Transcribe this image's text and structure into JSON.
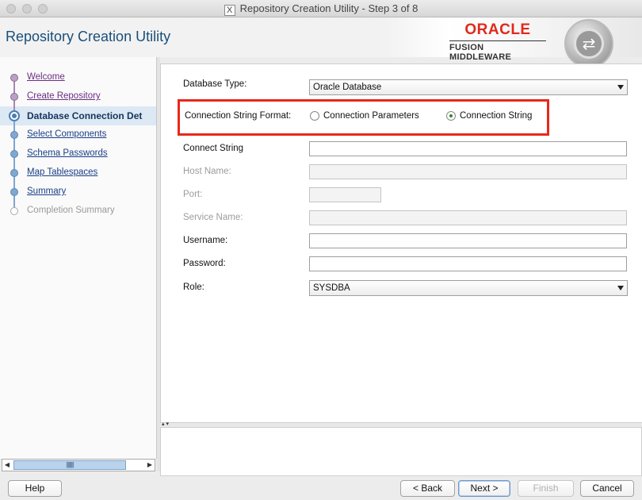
{
  "window": {
    "title": "Repository Creation Utility - Step 3 of 8"
  },
  "header": {
    "app_title": "Repository Creation Utility",
    "brand_name": "ORACLE",
    "brand_product": "FUSION MIDDLEWARE"
  },
  "nav": {
    "items": [
      {
        "label": "Welcome",
        "state": "visited"
      },
      {
        "label": "Create Repository",
        "state": "visited"
      },
      {
        "label": "Database Connection Det",
        "state": "current"
      },
      {
        "label": "Select Components",
        "state": "link"
      },
      {
        "label": "Schema Passwords",
        "state": "link"
      },
      {
        "label": "Map Tablespaces",
        "state": "link"
      },
      {
        "label": "Summary",
        "state": "link"
      },
      {
        "label": "Completion Summary",
        "state": "pending"
      }
    ]
  },
  "form": {
    "database_type_label": "Database Type:",
    "database_type_value": "Oracle Database",
    "connection_format_label": "Connection String Format:",
    "radio_parameters_label": "Connection Parameters",
    "radio_string_label": "Connection String",
    "selected_format": "Connection String",
    "connect_string_label": "Connect String",
    "connect_string_value": "",
    "host_name_label": "Host Name:",
    "port_label": "Port:",
    "service_name_label": "Service Name:",
    "username_label": "Username:",
    "username_value": "",
    "password_label": "Password:",
    "password_value": "",
    "role_label": "Role:",
    "role_value": "SYSDBA"
  },
  "buttons": {
    "help": "Help",
    "back": "< Back",
    "next": "Next >",
    "finish": "Finish",
    "cancel": "Cancel"
  },
  "colors": {
    "highlight_border": "#e8281a",
    "title_blue": "#1a4f7a",
    "brand_red": "#e0291c"
  }
}
